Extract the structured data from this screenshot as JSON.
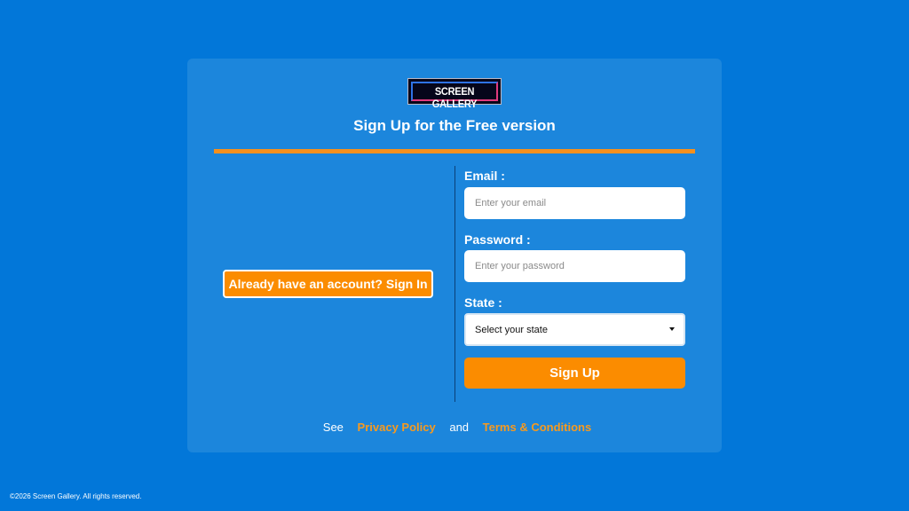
{
  "brand": {
    "logo_text": "SCREEN GALLERY"
  },
  "card": {
    "title": "Sign Up for the Free version"
  },
  "signin": {
    "button_label": "Already have an account? Sign In"
  },
  "form": {
    "email": {
      "label": "Email :",
      "placeholder": "Enter your email",
      "value": ""
    },
    "password": {
      "label": "Password :",
      "placeholder": "Enter your password",
      "value": ""
    },
    "state": {
      "label": "State :",
      "selected": "Select your state"
    },
    "submit_label": "Sign Up"
  },
  "links": {
    "see_text": "See",
    "privacy": "Privacy Policy",
    "and_text": "and",
    "terms": "Terms & Conditions"
  },
  "footer": {
    "copyright": "©2026 Screen Gallery. All rights reserved."
  },
  "colors": {
    "page_background": "#0277d9",
    "card_background": "#1c86dc",
    "accent_orange": "#fb8c00",
    "link_orange": "#f79a1f"
  },
  "icons": {
    "state_dropdown": "caret-down-icon"
  }
}
